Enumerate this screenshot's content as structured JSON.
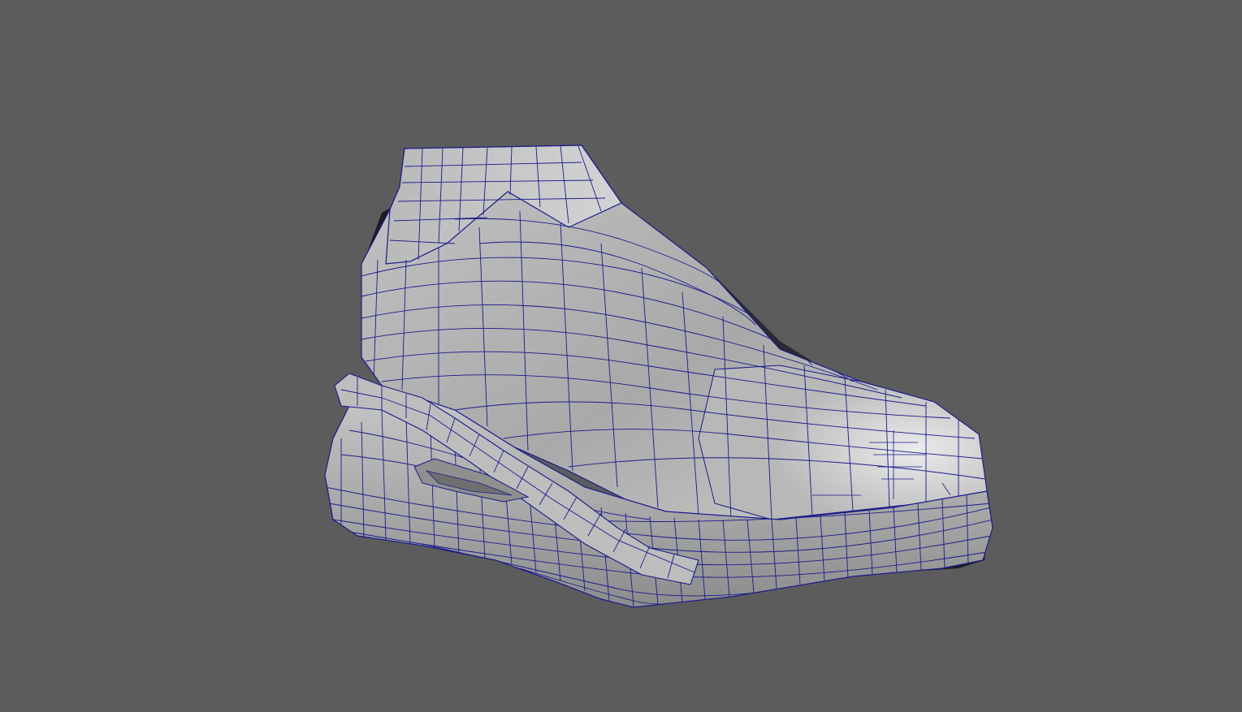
{
  "viewport": {
    "background_color": "#5c5c5c",
    "mesh_name_icon": "shoe-mesh-icon",
    "render_mode": "smooth-shaded-with-wireframe"
  },
  "model": {
    "surface_light": "#d9d9d9",
    "surface_mid": "#b3b3b3",
    "surface_dark": "#8a8a8a",
    "shadow_color": "#1c1c24",
    "wire_color": "#1a1a8c"
  }
}
